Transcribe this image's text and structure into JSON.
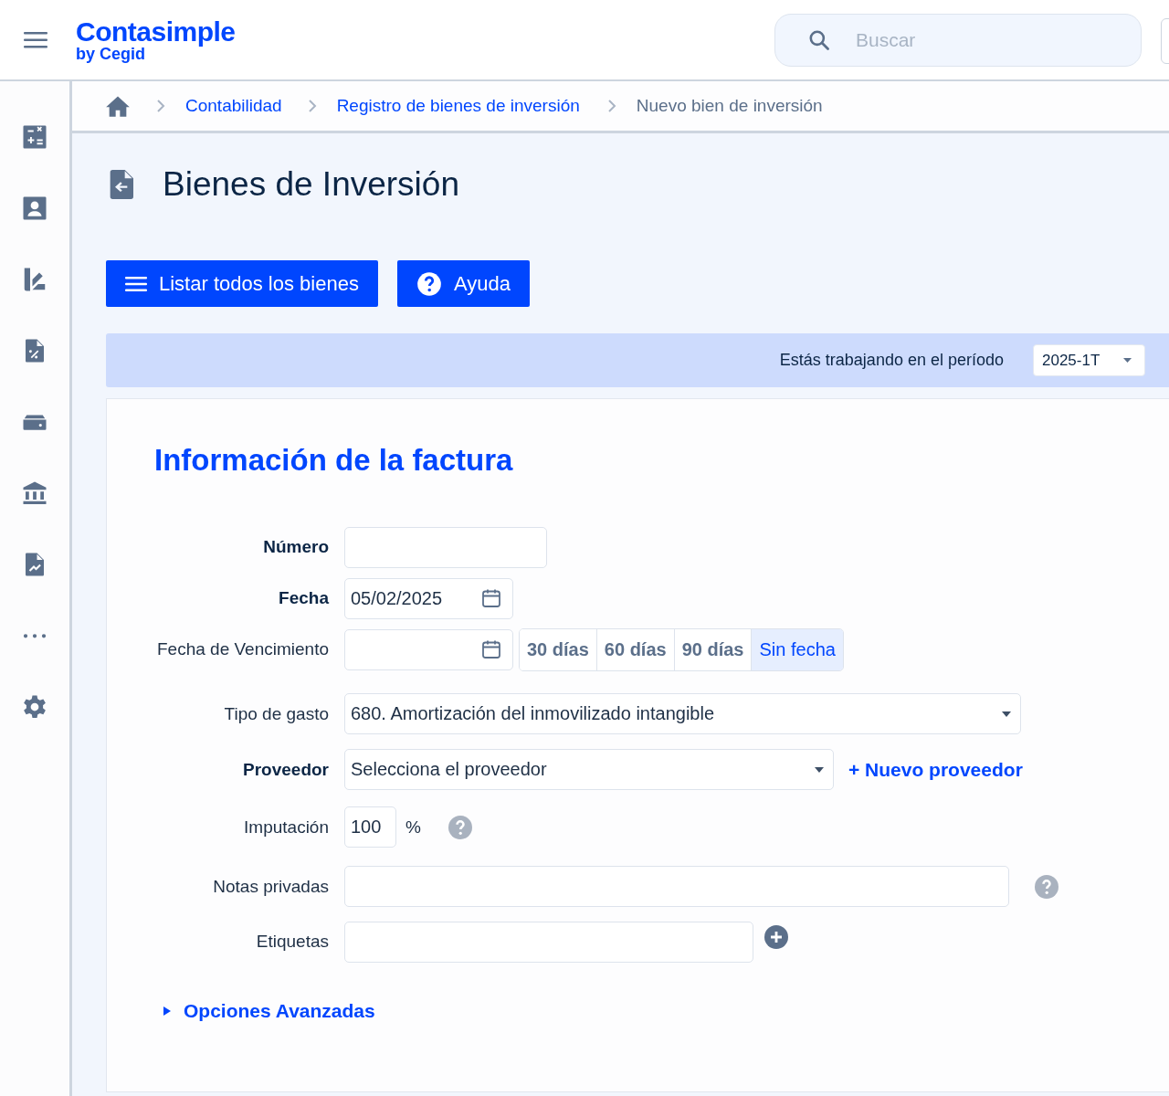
{
  "header": {
    "logo": "Contasimple",
    "logo_sub": "by Cegid",
    "search": {
      "placeholder": "Buscar"
    }
  },
  "breadcrumb": [
    {
      "label": "Contabilidad",
      "link": true
    },
    {
      "label": "Registro de bienes de inversión",
      "link": true
    },
    {
      "label": "Nuevo bien de inversión",
      "link": false
    }
  ],
  "page_title": "Bienes de Inversión",
  "actions": [
    {
      "kind": "list",
      "label": "Listar todos los bienes"
    },
    {
      "kind": "help",
      "label": "Ayuda"
    }
  ],
  "period": {
    "label": "Estás trabajando en el período",
    "value": "2025-1T"
  },
  "form": {
    "title": "Información de la factura",
    "fields": [
      {
        "kind": "text",
        "label": "Número",
        "required": true
      },
      {
        "kind": "date",
        "label": "Fecha",
        "required": true,
        "value": "05/02/2025"
      },
      {
        "kind": "date_terms",
        "label": "Fecha de Vencimiento",
        "required": false,
        "terms": [
          {
            "label": "30 días",
            "selected": false
          },
          {
            "label": "60 días",
            "selected": false
          },
          {
            "label": "90 días",
            "selected": false
          },
          {
            "label": "Sin fecha",
            "selected": true
          }
        ]
      },
      {
        "kind": "select",
        "label": "Tipo de gasto",
        "required": false,
        "value": "680. Amortización del inmovilizado intangible"
      },
      {
        "kind": "select_link",
        "label": "Proveedor",
        "required": true,
        "value": "Selecciona el proveedor",
        "link": "+ Nuevo proveedor"
      },
      {
        "kind": "percent",
        "label": "Imputación",
        "required": false,
        "value": "100",
        "unit": "%"
      },
      {
        "kind": "text_help",
        "label": "Notas privadas",
        "required": false
      },
      {
        "kind": "tags",
        "label": "Etiquetas",
        "required": false
      }
    ],
    "advanced": {
      "label": "Opciones Avanzadas",
      "expanded": false
    }
  }
}
